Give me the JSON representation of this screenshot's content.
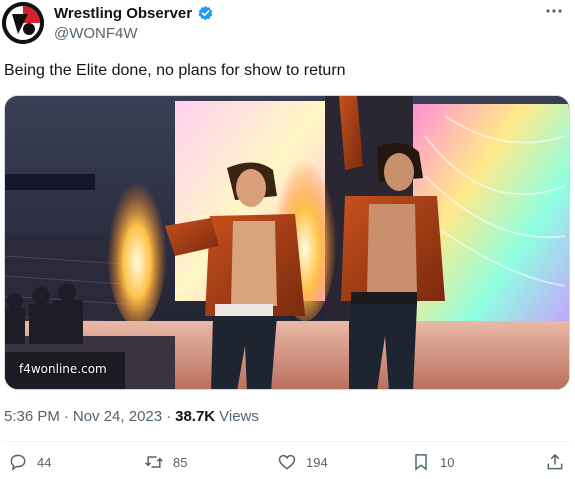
{
  "author": {
    "display_name": "Wrestling Observer",
    "handle": "@WONF4W",
    "verified": true
  },
  "post": {
    "text": "Being the Elite done, no plans for show to return",
    "media_watermark": "f4wonline.com"
  },
  "meta": {
    "time": "5:36 PM",
    "separator": "·",
    "date": "Nov 24, 2023",
    "views_count": "38.7K",
    "views_label": "Views"
  },
  "actions": {
    "replies": "44",
    "reposts": "85",
    "likes": "194",
    "bookmarks": "10"
  },
  "colors": {
    "text_primary": "#0f1419",
    "text_secondary": "#536471",
    "verified_blue": "#1d9bf0",
    "divider": "#eff3f4"
  }
}
